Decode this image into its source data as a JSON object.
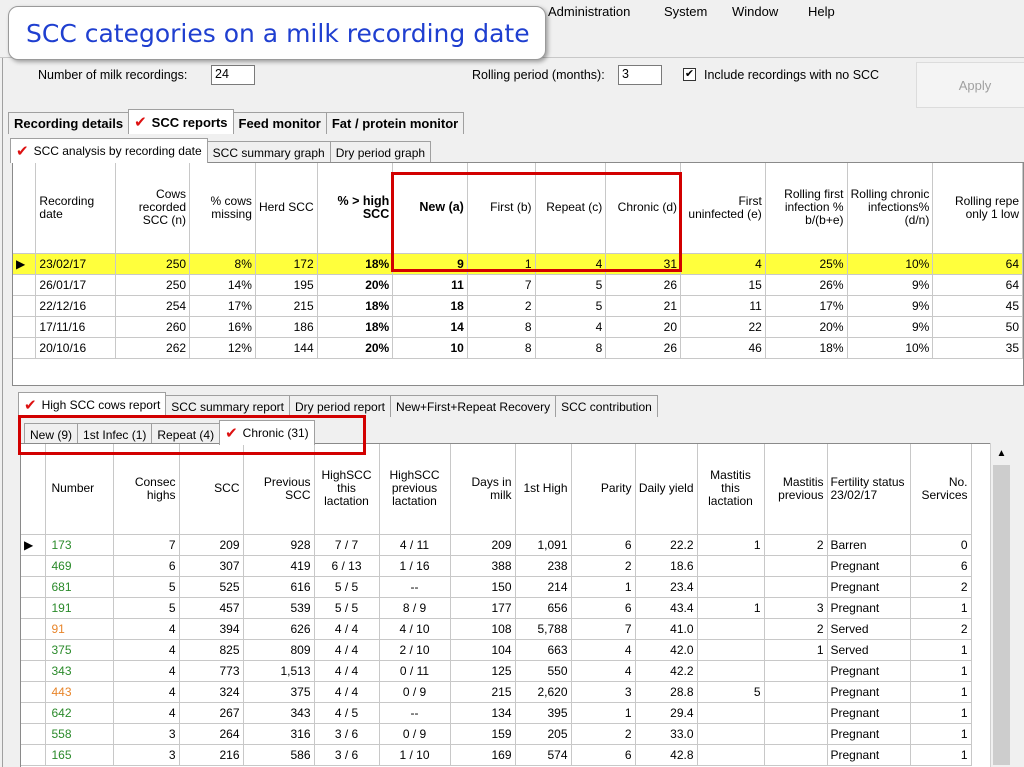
{
  "callout": {
    "text": "SCC categories on a milk recording date"
  },
  "menu": [
    "Administration",
    "System",
    "Window",
    "Help"
  ],
  "params": {
    "num_recordings_label": "Number of milk recordings:",
    "num_recordings_value": "24",
    "rolling_label": "Rolling period (months):",
    "rolling_value": "3",
    "include_check": "✔",
    "include_label": "Include recordings with no SCC",
    "apply_label": "Apply"
  },
  "main_tabs": [
    "Recording details",
    "SCC reports",
    "Feed monitor",
    "Fat / protein monitor"
  ],
  "sub_tabs": [
    "SCC analysis by recording date",
    "SCC summary graph",
    "Dry period graph"
  ],
  "analysis": {
    "headers": [
      "Recording date",
      "Cows recorded SCC (n)",
      "% cows missing",
      "Herd SCC",
      "% > high SCC",
      "New (a)",
      "First (b)",
      "Repeat (c)",
      "Chronic (d)",
      "First uninfected (e)",
      "Rolling first infection % b/(b+e)",
      "Rolling chronic infections% (d/n)",
      "Rolling repe only 1 low"
    ],
    "rows": [
      [
        "23/02/17",
        "250",
        "8%",
        "172",
        "18%",
        "9",
        "1",
        "4",
        "31",
        "4",
        "25%",
        "10%",
        "64"
      ],
      [
        "26/01/17",
        "250",
        "14%",
        "195",
        "20%",
        "11",
        "7",
        "5",
        "26",
        "15",
        "26%",
        "9%",
        "64"
      ],
      [
        "22/12/16",
        "254",
        "17%",
        "215",
        "18%",
        "18",
        "2",
        "5",
        "21",
        "11",
        "17%",
        "9%",
        "45"
      ],
      [
        "17/11/16",
        "260",
        "16%",
        "186",
        "18%",
        "14",
        "8",
        "4",
        "20",
        "22",
        "20%",
        "9%",
        "50"
      ],
      [
        "20/10/16",
        "262",
        "12%",
        "144",
        "20%",
        "10",
        "8",
        "8",
        "26",
        "46",
        "18%",
        "10%",
        "35"
      ]
    ]
  },
  "report_tabs": [
    "High SCC cows report",
    "SCC summary report",
    "Dry period report",
    "New+First+Repeat Recovery",
    "SCC contribution"
  ],
  "category_tabs": [
    "New (9)",
    "1st Infec (1)",
    "Repeat (4)",
    "Chronic (31)"
  ],
  "cows": {
    "headers": [
      "Number",
      "Consec highs",
      "SCC",
      "Previous SCC",
      "HighSCC this lactation",
      "HighSCC previous lactation",
      "Days in milk",
      "1st High",
      "Parity",
      "Daily yield",
      "Mastitis this lactation",
      "Mastitis previous",
      "Fertility status 23/02/17",
      "No. Services"
    ],
    "rows": [
      [
        "173",
        "7",
        "209",
        "928",
        "7 / 7",
        "4 / 11",
        "209",
        "1,091",
        "6",
        "22.2",
        "1",
        "2",
        "Barren",
        "0"
      ],
      [
        "469",
        "6",
        "307",
        "419",
        "6 / 13",
        "1 / 16",
        "388",
        "238",
        "2",
        "18.6",
        "",
        "",
        "Pregnant",
        "6"
      ],
      [
        "681",
        "5",
        "525",
        "616",
        "5 / 5",
        "--",
        "150",
        "214",
        "1",
        "23.4",
        "",
        "",
        "Pregnant",
        "2"
      ],
      [
        "191",
        "5",
        "457",
        "539",
        "5 / 5",
        "8 / 9",
        "177",
        "656",
        "6",
        "43.4",
        "1",
        "3",
        "Pregnant",
        "1"
      ],
      [
        "91",
        "4",
        "394",
        "626",
        "4 / 4",
        "4 / 10",
        "108",
        "5,788",
        "7",
        "41.0",
        "",
        "2",
        "Served",
        "2"
      ],
      [
        "375",
        "4",
        "825",
        "809",
        "4 / 4",
        "2 / 10",
        "104",
        "663",
        "4",
        "42.0",
        "",
        "1",
        "Served",
        "1"
      ],
      [
        "343",
        "4",
        "773",
        "1,513",
        "4 / 4",
        "0 / 11",
        "125",
        "550",
        "4",
        "42.2",
        "",
        "",
        "Pregnant",
        "1"
      ],
      [
        "443",
        "4",
        "324",
        "375",
        "4 / 4",
        "0 / 9",
        "215",
        "2,620",
        "3",
        "28.8",
        "5",
        "",
        "Pregnant",
        "1"
      ],
      [
        "642",
        "4",
        "267",
        "343",
        "4 / 5",
        "--",
        "134",
        "395",
        "1",
        "29.4",
        "",
        "",
        "Pregnant",
        "1"
      ],
      [
        "558",
        "3",
        "264",
        "316",
        "3 / 6",
        "0 / 9",
        "159",
        "205",
        "2",
        "33.0",
        "",
        "",
        "Pregnant",
        "1"
      ],
      [
        "165",
        "3",
        "216",
        "586",
        "3 / 6",
        "1 / 10",
        "169",
        "574",
        "6",
        "42.8",
        "",
        "",
        "Pregnant",
        "1"
      ]
    ],
    "number_colors": [
      "green",
      "green",
      "green",
      "green",
      "orange",
      "green",
      "green",
      "orange",
      "green",
      "green",
      "green"
    ]
  },
  "colors": {
    "highlight": "#ffff3c",
    "callout_text": "#1f3fd0",
    "annotation": "#d20000",
    "check": "#dd1111"
  }
}
